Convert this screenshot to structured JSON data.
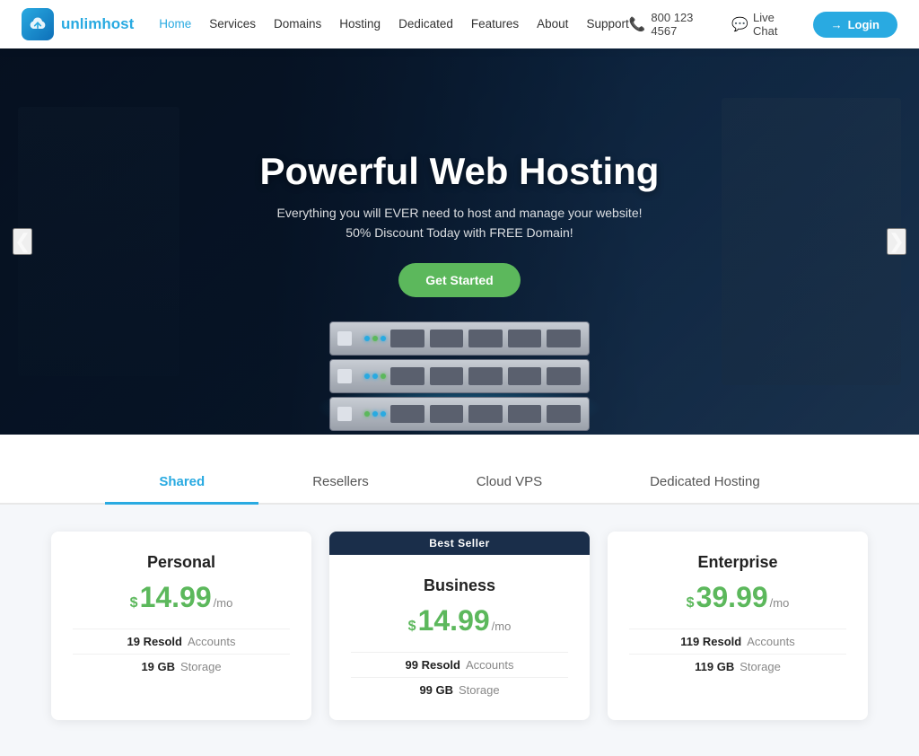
{
  "navbar": {
    "logo_text_part1": "unlim",
    "logo_text_part2": "host",
    "nav_links": [
      {
        "label": "Home",
        "active": true
      },
      {
        "label": "Services"
      },
      {
        "label": "Domains"
      },
      {
        "label": "Hosting"
      },
      {
        "label": "Dedicated"
      },
      {
        "label": "Features"
      },
      {
        "label": "About"
      },
      {
        "label": "Support"
      }
    ],
    "phone": "800 123 4567",
    "live_chat": "Live Chat",
    "login": "Login"
  },
  "hero": {
    "title": "Powerful Web Hosting",
    "subtitle1": "Everything you will EVER need to host and manage your website!",
    "subtitle2": "50% Discount Today with FREE Domain!",
    "cta": "Get Started"
  },
  "tabs": [
    {
      "label": "Shared",
      "active": true
    },
    {
      "label": "Resellers"
    },
    {
      "label": "Cloud VPS"
    },
    {
      "label": "Dedicated Hosting"
    }
  ],
  "plans": [
    {
      "name": "Personal",
      "price": "14.99",
      "per": "/mo",
      "best_seller": false,
      "features": [
        {
          "value": "19 Resold",
          "label": "Accounts"
        },
        {
          "value": "19 GB",
          "label": "Storage"
        }
      ]
    },
    {
      "name": "Business",
      "price": "14.99",
      "per": "/mo",
      "best_seller": true,
      "best_seller_label": "Best Seller",
      "features": [
        {
          "value": "99 Resold",
          "label": "Accounts"
        },
        {
          "value": "99 GB",
          "label": "Storage"
        }
      ]
    },
    {
      "name": "Enterprise",
      "price": "39.99",
      "per": "/mo",
      "best_seller": false,
      "features": [
        {
          "value": "119 Resold",
          "label": "Accounts"
        },
        {
          "value": "119 GB",
          "label": "Storage"
        }
      ]
    }
  ]
}
